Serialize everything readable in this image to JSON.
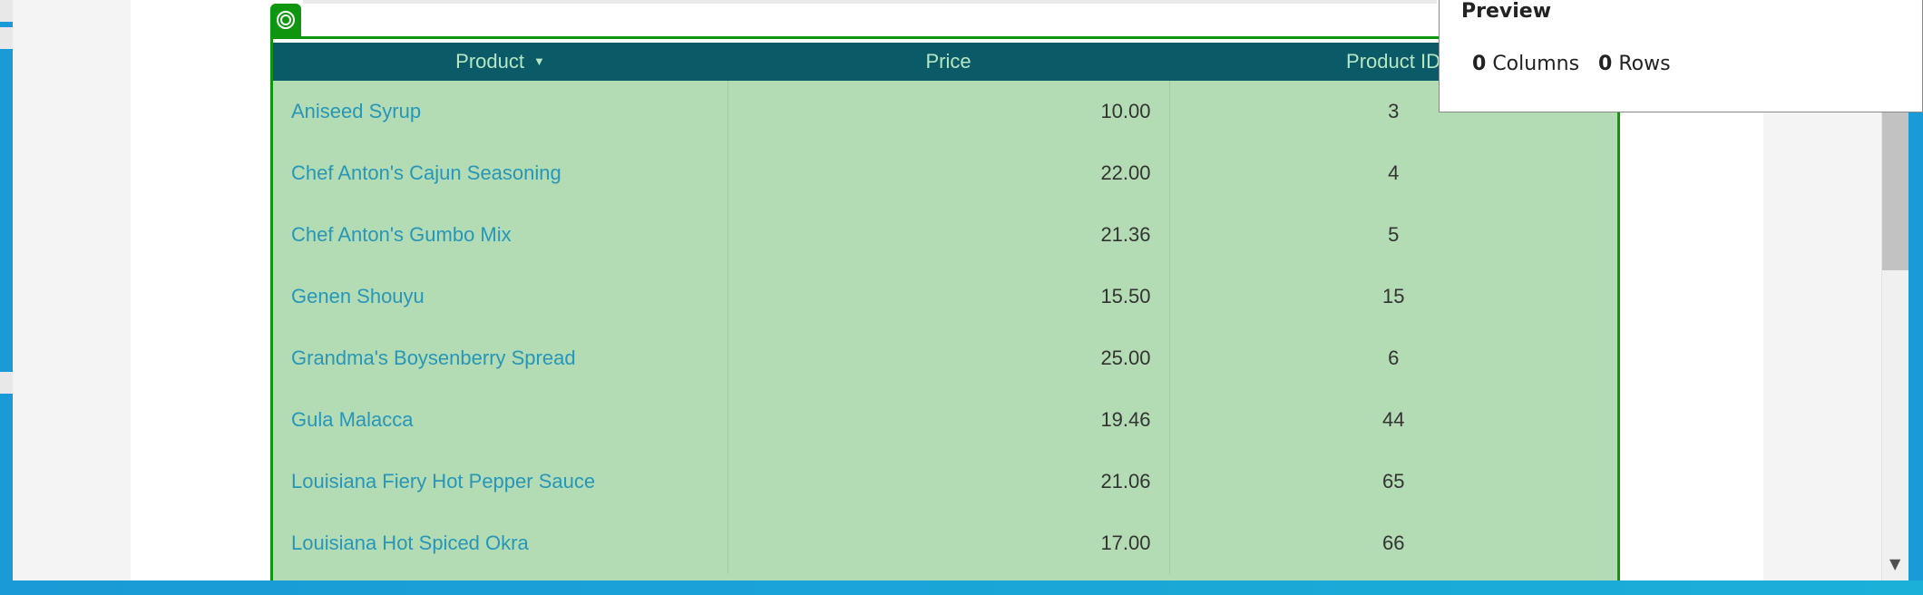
{
  "grid": {
    "columns": [
      {
        "label": "Product",
        "sort_indicator": "▼"
      },
      {
        "label": "Price"
      },
      {
        "label": "Product ID"
      }
    ],
    "rows": [
      {
        "product": "Aniseed Syrup",
        "price": "10.00",
        "id": "3"
      },
      {
        "product": "Chef Anton's Cajun Seasoning",
        "price": "22.00",
        "id": "4"
      },
      {
        "product": "Chef Anton's Gumbo Mix",
        "price": "21.36",
        "id": "5"
      },
      {
        "product": "Genen Shouyu",
        "price": "15.50",
        "id": "15"
      },
      {
        "product": "Grandma's Boysenberry Spread",
        "price": "25.00",
        "id": "6"
      },
      {
        "product": "Gula Malacca",
        "price": "19.46",
        "id": "44"
      },
      {
        "product": "Louisiana Fiery Hot Pepper Sauce",
        "price": "21.06",
        "id": "65"
      },
      {
        "product": "Louisiana Hot Spiced Okra",
        "price": "17.00",
        "id": "66"
      }
    ]
  },
  "preview": {
    "title": "Preview",
    "columns_count": "0",
    "columns_label": "Columns",
    "rows_count": "0",
    "rows_label": "Rows"
  },
  "colors": {
    "header_bg": "#0b5a68",
    "grid_bg": "#b4dcb4",
    "selection_border": "#10960e",
    "link_text": "#2796b8"
  },
  "icons": {
    "grid_tag": "target-icon",
    "scroll_down": "scroll-down-arrow-icon"
  }
}
